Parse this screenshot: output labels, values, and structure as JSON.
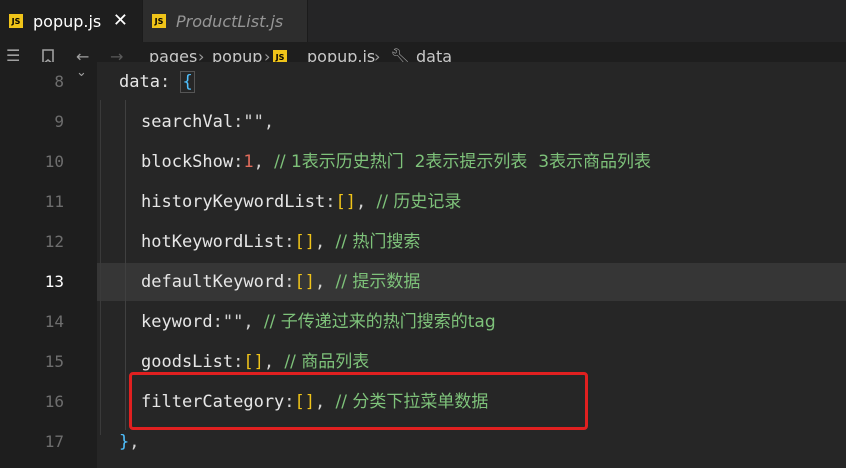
{
  "tabs": [
    {
      "icon": "JS",
      "label": "popup.js",
      "close": "✕"
    },
    {
      "icon": "JS",
      "label": "ProductList.js"
    }
  ],
  "breadcrumb": {
    "items": [
      "pages",
      "popup"
    ],
    "file_icon": "JS",
    "file": "popup.js",
    "symbol": "data",
    "separator": "›"
  },
  "lines": [
    {
      "n": "8"
    },
    {
      "n": "9"
    },
    {
      "n": "10"
    },
    {
      "n": "11"
    },
    {
      "n": "12"
    },
    {
      "n": "13"
    },
    {
      "n": "14"
    },
    {
      "n": "15"
    },
    {
      "n": "16"
    },
    {
      "n": "17"
    }
  ],
  "code": {
    "l8": {
      "key": "data",
      "colon": ":",
      "brace": "{"
    },
    "l9": {
      "key": "searchVal",
      "colon": ":",
      "value": "\"\"",
      "comma": ","
    },
    "l10": {
      "key": "blockShow",
      "colon": ":",
      "value": "1",
      "comma": ",",
      "comment": "// 1表示历史热门  2表示提示列表  3表示商品列表"
    },
    "l11": {
      "key": "historyKeywordList",
      "colon": ":",
      "value": "[]",
      "comma": ",",
      "comment": "// 历史记录"
    },
    "l12": {
      "key": "hotKeywordList",
      "colon": ":",
      "value": "[]",
      "comma": ",",
      "comment": "// 热门搜索"
    },
    "l13": {
      "key": "defaultKeyword",
      "colon": ":",
      "value": "[]",
      "comma": ",",
      "comment": "// 提示数据"
    },
    "l14": {
      "key": "keyword",
      "colon": ":",
      "value": "\"\"",
      "comma": ",",
      "comment": "// 子传递过来的热门搜索的tag"
    },
    "l15": {
      "key": "goodsList",
      "colon": ":",
      "value": "[]",
      "comma": ",",
      "comment": "// 商品列表"
    },
    "l16": {
      "key": "filterCategory",
      "colon": ":",
      "value": "[]",
      "comma": ",",
      "comment": "// 分类下拉菜单数据"
    },
    "l17": {
      "brace": "}",
      "comma": ","
    }
  },
  "colors": {
    "highlight_box": "#e02020",
    "js_icon": "#f0c419",
    "comment": "#7ec27a",
    "number": "#e06c5b"
  }
}
